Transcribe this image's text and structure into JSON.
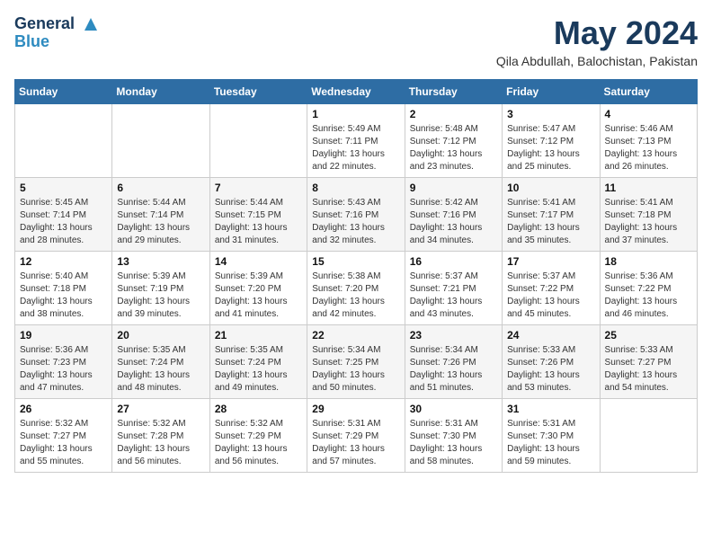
{
  "header": {
    "logo_line1": "General",
    "logo_line2": "Blue",
    "month_title": "May 2024",
    "location": "Qila Abdullah, Balochistan, Pakistan"
  },
  "days_of_week": [
    "Sunday",
    "Monday",
    "Tuesday",
    "Wednesday",
    "Thursday",
    "Friday",
    "Saturday"
  ],
  "weeks": [
    [
      {
        "day": "",
        "sunrise": "",
        "sunset": "",
        "daylight": ""
      },
      {
        "day": "",
        "sunrise": "",
        "sunset": "",
        "daylight": ""
      },
      {
        "day": "",
        "sunrise": "",
        "sunset": "",
        "daylight": ""
      },
      {
        "day": "1",
        "sunrise": "Sunrise: 5:49 AM",
        "sunset": "Sunset: 7:11 PM",
        "daylight": "Daylight: 13 hours and 22 minutes."
      },
      {
        "day": "2",
        "sunrise": "Sunrise: 5:48 AM",
        "sunset": "Sunset: 7:12 PM",
        "daylight": "Daylight: 13 hours and 23 minutes."
      },
      {
        "day": "3",
        "sunrise": "Sunrise: 5:47 AM",
        "sunset": "Sunset: 7:12 PM",
        "daylight": "Daylight: 13 hours and 25 minutes."
      },
      {
        "day": "4",
        "sunrise": "Sunrise: 5:46 AM",
        "sunset": "Sunset: 7:13 PM",
        "daylight": "Daylight: 13 hours and 26 minutes."
      }
    ],
    [
      {
        "day": "5",
        "sunrise": "Sunrise: 5:45 AM",
        "sunset": "Sunset: 7:14 PM",
        "daylight": "Daylight: 13 hours and 28 minutes."
      },
      {
        "day": "6",
        "sunrise": "Sunrise: 5:44 AM",
        "sunset": "Sunset: 7:14 PM",
        "daylight": "Daylight: 13 hours and 29 minutes."
      },
      {
        "day": "7",
        "sunrise": "Sunrise: 5:44 AM",
        "sunset": "Sunset: 7:15 PM",
        "daylight": "Daylight: 13 hours and 31 minutes."
      },
      {
        "day": "8",
        "sunrise": "Sunrise: 5:43 AM",
        "sunset": "Sunset: 7:16 PM",
        "daylight": "Daylight: 13 hours and 32 minutes."
      },
      {
        "day": "9",
        "sunrise": "Sunrise: 5:42 AM",
        "sunset": "Sunset: 7:16 PM",
        "daylight": "Daylight: 13 hours and 34 minutes."
      },
      {
        "day": "10",
        "sunrise": "Sunrise: 5:41 AM",
        "sunset": "Sunset: 7:17 PM",
        "daylight": "Daylight: 13 hours and 35 minutes."
      },
      {
        "day": "11",
        "sunrise": "Sunrise: 5:41 AM",
        "sunset": "Sunset: 7:18 PM",
        "daylight": "Daylight: 13 hours and 37 minutes."
      }
    ],
    [
      {
        "day": "12",
        "sunrise": "Sunrise: 5:40 AM",
        "sunset": "Sunset: 7:18 PM",
        "daylight": "Daylight: 13 hours and 38 minutes."
      },
      {
        "day": "13",
        "sunrise": "Sunrise: 5:39 AM",
        "sunset": "Sunset: 7:19 PM",
        "daylight": "Daylight: 13 hours and 39 minutes."
      },
      {
        "day": "14",
        "sunrise": "Sunrise: 5:39 AM",
        "sunset": "Sunset: 7:20 PM",
        "daylight": "Daylight: 13 hours and 41 minutes."
      },
      {
        "day": "15",
        "sunrise": "Sunrise: 5:38 AM",
        "sunset": "Sunset: 7:20 PM",
        "daylight": "Daylight: 13 hours and 42 minutes."
      },
      {
        "day": "16",
        "sunrise": "Sunrise: 5:37 AM",
        "sunset": "Sunset: 7:21 PM",
        "daylight": "Daylight: 13 hours and 43 minutes."
      },
      {
        "day": "17",
        "sunrise": "Sunrise: 5:37 AM",
        "sunset": "Sunset: 7:22 PM",
        "daylight": "Daylight: 13 hours and 45 minutes."
      },
      {
        "day": "18",
        "sunrise": "Sunrise: 5:36 AM",
        "sunset": "Sunset: 7:22 PM",
        "daylight": "Daylight: 13 hours and 46 minutes."
      }
    ],
    [
      {
        "day": "19",
        "sunrise": "Sunrise: 5:36 AM",
        "sunset": "Sunset: 7:23 PM",
        "daylight": "Daylight: 13 hours and 47 minutes."
      },
      {
        "day": "20",
        "sunrise": "Sunrise: 5:35 AM",
        "sunset": "Sunset: 7:24 PM",
        "daylight": "Daylight: 13 hours and 48 minutes."
      },
      {
        "day": "21",
        "sunrise": "Sunrise: 5:35 AM",
        "sunset": "Sunset: 7:24 PM",
        "daylight": "Daylight: 13 hours and 49 minutes."
      },
      {
        "day": "22",
        "sunrise": "Sunrise: 5:34 AM",
        "sunset": "Sunset: 7:25 PM",
        "daylight": "Daylight: 13 hours and 50 minutes."
      },
      {
        "day": "23",
        "sunrise": "Sunrise: 5:34 AM",
        "sunset": "Sunset: 7:26 PM",
        "daylight": "Daylight: 13 hours and 51 minutes."
      },
      {
        "day": "24",
        "sunrise": "Sunrise: 5:33 AM",
        "sunset": "Sunset: 7:26 PM",
        "daylight": "Daylight: 13 hours and 53 minutes."
      },
      {
        "day": "25",
        "sunrise": "Sunrise: 5:33 AM",
        "sunset": "Sunset: 7:27 PM",
        "daylight": "Daylight: 13 hours and 54 minutes."
      }
    ],
    [
      {
        "day": "26",
        "sunrise": "Sunrise: 5:32 AM",
        "sunset": "Sunset: 7:27 PM",
        "daylight": "Daylight: 13 hours and 55 minutes."
      },
      {
        "day": "27",
        "sunrise": "Sunrise: 5:32 AM",
        "sunset": "Sunset: 7:28 PM",
        "daylight": "Daylight: 13 hours and 56 minutes."
      },
      {
        "day": "28",
        "sunrise": "Sunrise: 5:32 AM",
        "sunset": "Sunset: 7:29 PM",
        "daylight": "Daylight: 13 hours and 56 minutes."
      },
      {
        "day": "29",
        "sunrise": "Sunrise: 5:31 AM",
        "sunset": "Sunset: 7:29 PM",
        "daylight": "Daylight: 13 hours and 57 minutes."
      },
      {
        "day": "30",
        "sunrise": "Sunrise: 5:31 AM",
        "sunset": "Sunset: 7:30 PM",
        "daylight": "Daylight: 13 hours and 58 minutes."
      },
      {
        "day": "31",
        "sunrise": "Sunrise: 5:31 AM",
        "sunset": "Sunset: 7:30 PM",
        "daylight": "Daylight: 13 hours and 59 minutes."
      },
      {
        "day": "",
        "sunrise": "",
        "sunset": "",
        "daylight": ""
      }
    ]
  ]
}
